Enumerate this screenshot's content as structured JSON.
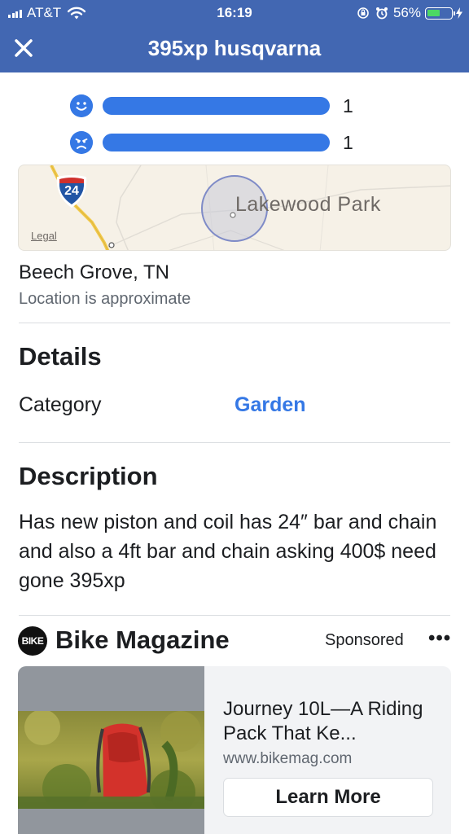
{
  "status_bar": {
    "carrier": "AT&T",
    "time": "16:19",
    "battery_percent": "56%",
    "battery_level": 0.56
  },
  "header": {
    "title": "395xp husqvarna",
    "close_icon": "close-icon"
  },
  "ratings": [
    {
      "icon": "happy-face-icon",
      "count": "1",
      "fill": 1.0
    },
    {
      "icon": "sad-face-icon",
      "count": "1",
      "fill": 1.0
    }
  ],
  "map": {
    "place_label": "Lakewood Park",
    "highway_shield": "24",
    "legal_label": "Legal"
  },
  "location": {
    "city": "Beech Grove, TN",
    "note": "Location is approximate"
  },
  "details": {
    "heading": "Details",
    "category_label": "Category",
    "category_value": "Garden"
  },
  "description": {
    "heading": "Description",
    "text": "Has new piston and coil has 24″ bar and chain and also a 4ft bar and chain asking 400$ need gone 395xp"
  },
  "ad": {
    "logo_text": "BIKE",
    "advertiser": "Bike Magazine",
    "sponsored_label": "Sponsored",
    "more_label": "•••",
    "title": "Journey 10L—A Riding Pack That Ke...",
    "url": "www.bikemag.com",
    "cta_label": "Learn More"
  },
  "colors": {
    "header_bg": "#4267b2",
    "accent": "#3578e5",
    "battery_green": "#4cd964"
  }
}
